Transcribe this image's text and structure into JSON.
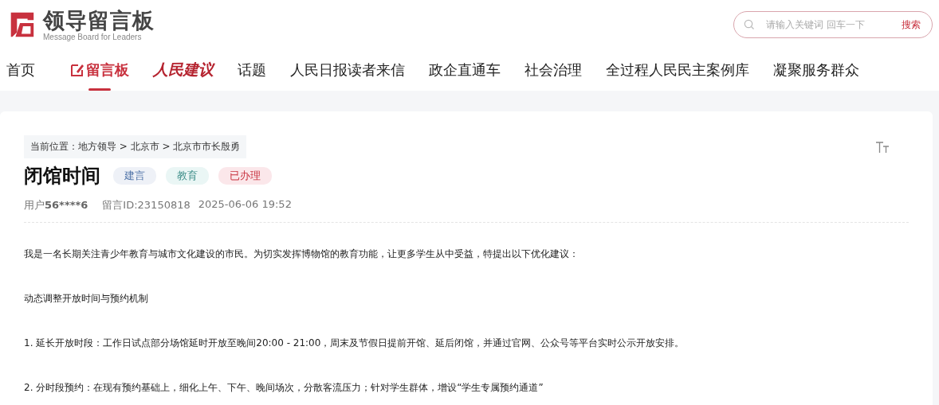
{
  "logo": {
    "title": "领导留言板",
    "subtitle": "Message Board for Leaders"
  },
  "search": {
    "placeholder": "请输入关键词 回车一下",
    "button": "搜索"
  },
  "nav": [
    {
      "label": "首页",
      "kind": "plain",
      "selected": false
    },
    {
      "label": "留言板",
      "kind": "board",
      "selected": true
    },
    {
      "label": "人民建议",
      "kind": "brand",
      "selected": false
    },
    {
      "label": "话题",
      "kind": "plain",
      "selected": false
    },
    {
      "label": "人民日报读者来信",
      "kind": "plain",
      "selected": false
    },
    {
      "label": "政企直通车",
      "kind": "plain",
      "selected": false
    },
    {
      "label": "社会治理",
      "kind": "plain",
      "selected": false
    },
    {
      "label": "全过程人民民主案例库",
      "kind": "plain",
      "selected": false
    },
    {
      "label": "凝聚服务群众",
      "kind": "plain",
      "selected": false
    }
  ],
  "breadcrumb": "当前位置：地方领导 > 北京市 > 北京市市长殷勇",
  "title": "闭馆时间",
  "tags": [
    {
      "label": "建言",
      "color": "#eef1f7"
    },
    {
      "label": "教育",
      "color": "#eaf6f5"
    },
    {
      "label": "已办理",
      "color": "#fbe7ea"
    }
  ],
  "meta": {
    "user_prefix": "用户",
    "user_id": "56****6",
    "message_id": "留言ID:23150818",
    "time": "2025-06-06 19:52"
  },
  "paragraphs": [
    "我是一名长期关注青少年教育与城市文化建设的市民。为切实发挥博物馆的教育功能，让更多学生从中受益，特提出以下优化建议：",
    "动态调整开放时间与预约机制",
    "1. 延长开放时段：工作日试点部分场馆延时开放至晚间20:00 - 21:00，周末及节假日提前开馆、延后闭馆，并通过官网、公众号等平台实时公示开放安排。",
    "2. 分时段预约：在现有预约基础上，细化上午、下午、晚间场次，分散客流压力；针对学生群体，增设“学生专属预约通道”"
  ]
}
